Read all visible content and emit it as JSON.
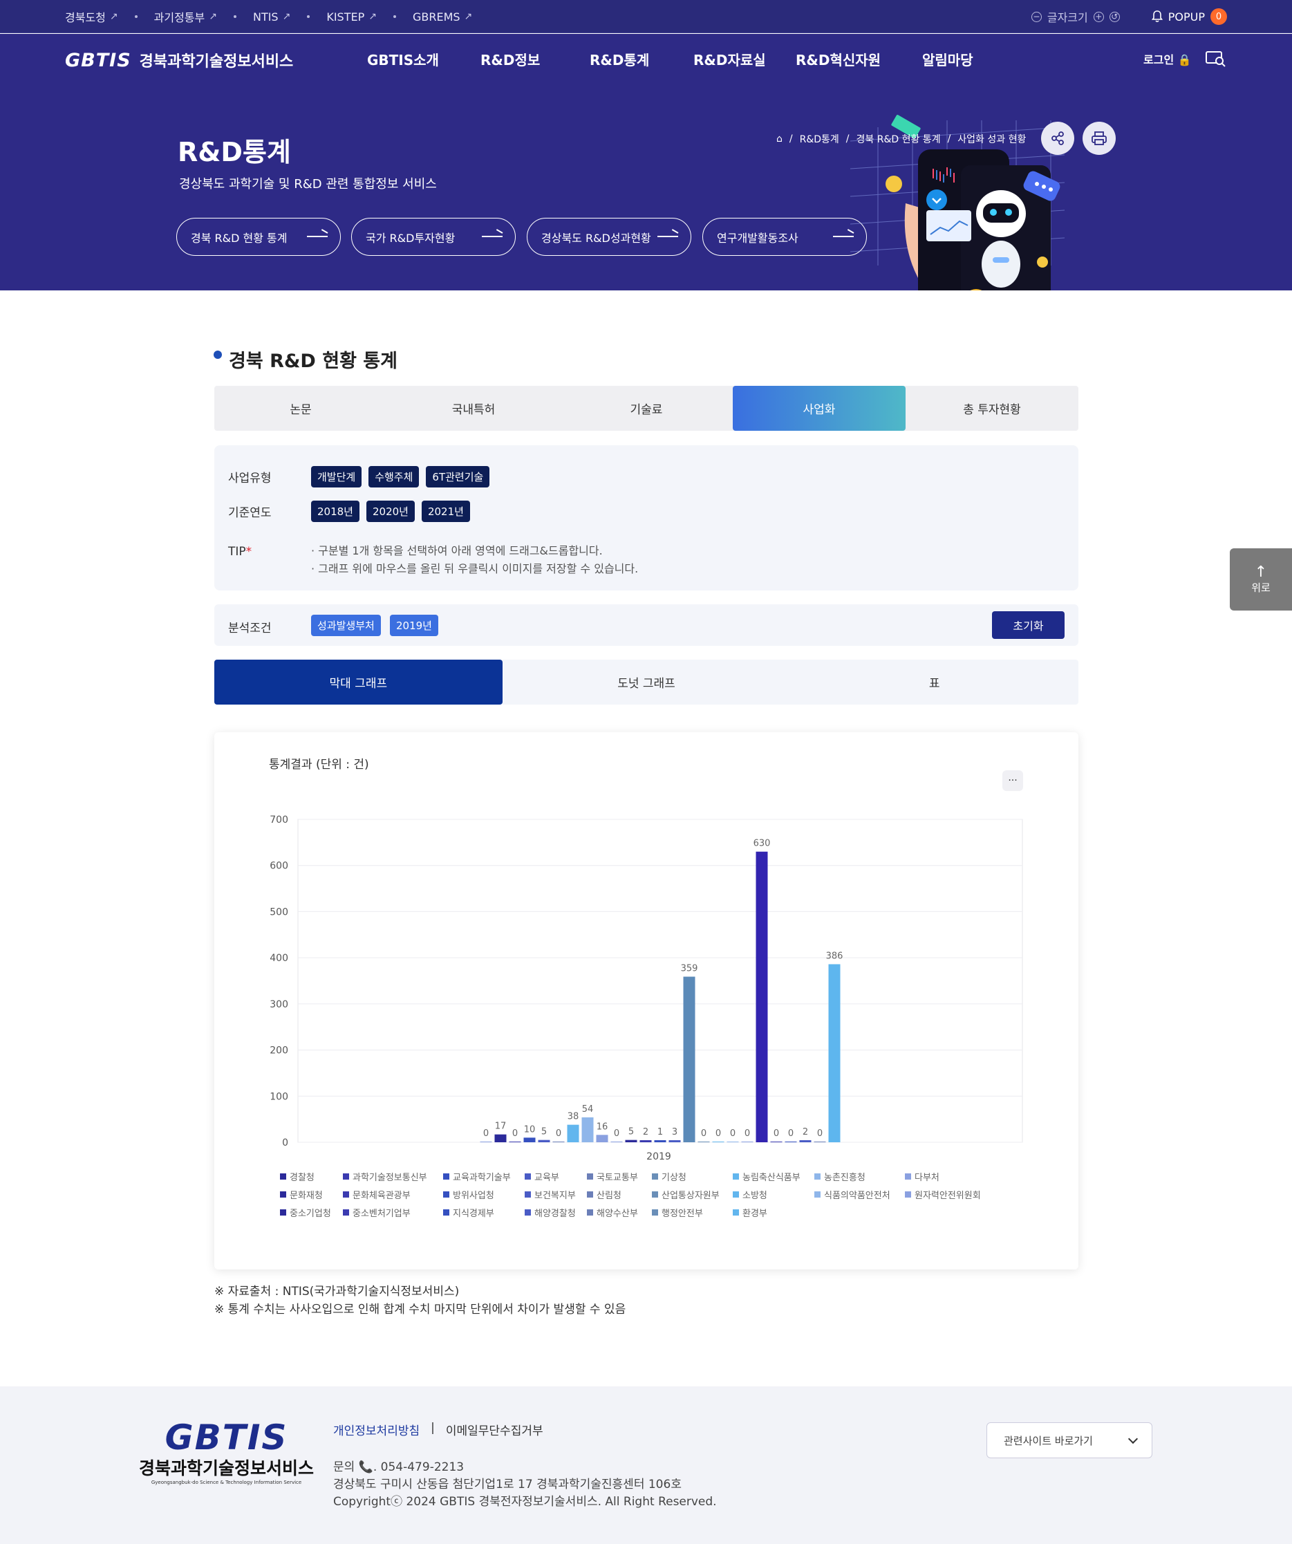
{
  "topbar": {
    "links": [
      {
        "label": "경북도청"
      },
      {
        "label": "과기정통부"
      },
      {
        "label": "NTIS"
      },
      {
        "label": "KISTEP"
      },
      {
        "label": "GBREMS"
      }
    ],
    "font_size_label": "글자크기",
    "popup_label": "POPUP",
    "popup_count": "0"
  },
  "header": {
    "logo_text": "GBTIS",
    "logo_kr": "경북과학기술정보서비스",
    "nav": [
      "GBTIS소개",
      "R&D정보",
      "R&D통계",
      "R&D자료실",
      "R&D혁신자원",
      "알림마당"
    ],
    "login_label": "로그인"
  },
  "hero": {
    "title": "R&D통계",
    "subtitle": "경상북도 과학기술 및 R&D 관련 통합정보 서비스",
    "pills": [
      "경북 R&D 현황 통계",
      "국가 R&D투자현황",
      "경상북도 R&D성과현황",
      "연구개발활동조사"
    ],
    "breadcrumb": [
      "R&D통계",
      "경북 R&D 현황 통계",
      "사업화 성과 현황"
    ]
  },
  "main": {
    "section_title": "경북 R&D 현황 통계",
    "tabs": [
      "논문",
      "국내특허",
      "기술료",
      "사업화",
      "총 투자현황"
    ],
    "active_tab": "사업화",
    "filters": {
      "type_label": "사업유형",
      "type_chips": [
        "개발단계",
        "수행주체",
        "6T관련기술"
      ],
      "year_label": "기준연도",
      "year_chips": [
        "2018년",
        "2020년",
        "2021년"
      ],
      "tip_label": "TIP",
      "tip_lines": [
        "· 구분별 1개 항목을 선택하여 아래 영역에 드래그&드롭합니다.",
        "· 그래프 위에 마우스를 올린 뒤 우클릭시 이미지를 저장할 수 있습니다."
      ]
    },
    "condition": {
      "label": "분석조건",
      "chips": [
        "성과발생부처",
        "2019년"
      ],
      "reset_label": "초기화"
    },
    "graph_tabs": [
      "막대 그래프",
      "도넛 그래프",
      "표"
    ],
    "active_graph_tab": "막대 그래프",
    "chart_title": "통계결과 (단위 : 건)",
    "menu_label": "···",
    "notes": [
      "※ 자료출처 : NTIS(국가과학기술지식정보서비스)",
      "※ 통계 수치는 사사오입으로 인해 합계 수치 마지막 단위에서 차이가 발생할 수 있음"
    ]
  },
  "chart_data": {
    "type": "bar",
    "title": "",
    "xlabel": "",
    "ylabel": "",
    "categories": [
      "2019"
    ],
    "ylim": [
      0,
      700
    ],
    "yticks": [
      0,
      100,
      200,
      300,
      400,
      500,
      600,
      700
    ],
    "grid": true,
    "legend_position": "bottom",
    "label_positions": [
      {
        "name": "경찰청",
        "value": null
      },
      {
        "name": "과학기술정보통신부",
        "value": null
      },
      {
        "name": "교육과학기술부",
        "value": null
      },
      {
        "name": "교육부",
        "value": null
      },
      {
        "name": "국토교통부",
        "value": null
      },
      {
        "name": "기상청",
        "value": null
      },
      {
        "name": "농림축산식품부",
        "value": null
      },
      {
        "name": "농촌진흥청",
        "value": null
      },
      {
        "name": "다부처",
        "value": null
      }
    ],
    "series": [
      {
        "name": "경찰청",
        "values": [
          null
        ],
        "color": "#2b2a9a"
      },
      {
        "name": "과학기술정보통신부",
        "values": [
          null
        ],
        "color": "#3b3bb0"
      },
      {
        "name": "교육과학기술부",
        "values": [
          null
        ],
        "color": "#3550c0"
      },
      {
        "name": "교육부",
        "values": [
          null
        ],
        "color": "#4a5cc6"
      },
      {
        "name": "국토교통부",
        "values": [
          null
        ],
        "color": "#6b7fb8"
      },
      {
        "name": "기상청",
        "values": [
          null
        ],
        "color": "#6a8fb8"
      },
      {
        "name": "농림축산식품부",
        "values": [
          null
        ],
        "color": "#62b6ee"
      },
      {
        "name": "농촌진흥청",
        "values": [
          null
        ],
        "color": "#8fb6ea"
      },
      {
        "name": "다부처",
        "values": [
          0
        ],
        "color": "#8aa0e0"
      },
      {
        "name": "문화재청",
        "values": [
          17
        ],
        "color": "#2b2a9a"
      },
      {
        "name": "문화체육관광부",
        "values": [
          0
        ],
        "color": "#3b3bb0"
      },
      {
        "name": "방위사업청",
        "values": [
          10
        ],
        "color": "#3550c0"
      },
      {
        "name": "보건복지부",
        "values": [
          5
        ],
        "color": "#4a5cc6"
      },
      {
        "name": "산림청",
        "values": [
          0
        ],
        "color": "#6b7fb8"
      },
      {
        "name": "산업통상자원부",
        "values": [
          38
        ],
        "color": "#62b6ee"
      },
      {
        "name": "소방청",
        "values": [
          54
        ],
        "color": "#8fb6ea"
      },
      {
        "name": "식품의약품안전처",
        "values": [
          16
        ],
        "color": "#8aa0e0"
      },
      {
        "name": "원자력안전위원회",
        "values": [
          0
        ],
        "color": "#8aa0e0"
      },
      {
        "name": "중소기업청",
        "values": [
          5
        ],
        "color": "#2b2a9a"
      },
      {
        "name": "중소벤처기업부",
        "values": [
          2
        ],
        "color": "#3b3bb0"
      },
      {
        "name": "지식경제부",
        "values": [
          1
        ],
        "color": "#3550c0"
      },
      {
        "name": "해양경찰청",
        "values": [
          3
        ],
        "color": "#4a5cc6"
      },
      {
        "name": "해양수산부",
        "values": [
          359
        ],
        "color": "#5b8ab8"
      },
      {
        "name": "행정안전부",
        "values": [
          0
        ],
        "color": "#6a8fb8"
      },
      {
        "name": "환경부",
        "values": [
          0
        ],
        "color": "#62b6ee"
      }
    ],
    "bars": [
      {
        "label": "0",
        "value": 0,
        "color": "#8aa0e0"
      },
      {
        "label": "17",
        "value": 17,
        "color": "#2b2a9a"
      },
      {
        "label": "0",
        "value": 0,
        "color": "#3b3bb0"
      },
      {
        "label": "10",
        "value": 10,
        "color": "#3550c0"
      },
      {
        "label": "5",
        "value": 5,
        "color": "#4a5cc6"
      },
      {
        "label": "0",
        "value": 0,
        "color": "#6b7fb8"
      },
      {
        "label": "38",
        "value": 38,
        "color": "#62b6ee"
      },
      {
        "label": "54",
        "value": 54,
        "color": "#8fb6ea"
      },
      {
        "label": "16",
        "value": 16,
        "color": "#8aa0e0"
      },
      {
        "label": "0",
        "value": 0,
        "color": "#8aa0e0"
      },
      {
        "label": "5",
        "value": 5,
        "color": "#2b2a9a"
      },
      {
        "label": "2",
        "value": 2,
        "color": "#3b3bb0"
      },
      {
        "label": "1",
        "value": 1,
        "color": "#3550c0"
      },
      {
        "label": "3",
        "value": 3,
        "color": "#4a5cc6"
      },
      {
        "label": "359",
        "value": 359,
        "color": "#5b8ab8"
      },
      {
        "label": "0",
        "value": 0,
        "color": "#6a8fb8"
      },
      {
        "label": "0",
        "value": 0,
        "color": "#62b6ee"
      },
      {
        "label": "0",
        "value": 0,
        "color": "#8fb6ea"
      },
      {
        "label": "0",
        "value": 0,
        "color": "#8aa0e0"
      },
      {
        "label": "630",
        "value": 630,
        "color": "#3224b0"
      },
      {
        "label": "0",
        "value": 0,
        "color": "#3b3bb0"
      },
      {
        "label": "0",
        "value": 0,
        "color": "#3550c0"
      },
      {
        "label": "2",
        "value": 2,
        "color": "#4a5cc6"
      },
      {
        "label": "0",
        "value": 0,
        "color": "#6b7fb8"
      },
      {
        "label": "386",
        "value": 386,
        "color": "#5eb6ee"
      }
    ],
    "legend": [
      {
        "name": "경찰청",
        "color": "#2b2a9a"
      },
      {
        "name": "과학기술정보통신부",
        "color": "#3b3bb0"
      },
      {
        "name": "교육과학기술부",
        "color": "#3550c0"
      },
      {
        "name": "교육부",
        "color": "#4a5cc6"
      },
      {
        "name": "국토교통부",
        "color": "#6b7fb8"
      },
      {
        "name": "기상청",
        "color": "#6a8fb8"
      },
      {
        "name": "농림축산식품부",
        "color": "#62b6ee"
      },
      {
        "name": "농촌진흥청",
        "color": "#8fb6ea"
      },
      {
        "name": "다부처",
        "color": "#8aa0e0"
      },
      {
        "name": "문화재청",
        "color": "#2b2a9a"
      },
      {
        "name": "문화체육관광부",
        "color": "#3b3bb0"
      },
      {
        "name": "방위사업청",
        "color": "#3550c0"
      },
      {
        "name": "보건복지부",
        "color": "#4a5cc6"
      },
      {
        "name": "산림청",
        "color": "#6b7fb8"
      },
      {
        "name": "산업통상자원부",
        "color": "#6a8fb8"
      },
      {
        "name": "소방청",
        "color": "#62b6ee"
      },
      {
        "name": "식품의약품안전처",
        "color": "#8fb6ea"
      },
      {
        "name": "원자력안전위원회",
        "color": "#8aa0e0"
      },
      {
        "name": "중소기업청",
        "color": "#2b2a9a"
      },
      {
        "name": "중소벤처기업부",
        "color": "#3b3bb0"
      },
      {
        "name": "지식경제부",
        "color": "#3550c0"
      },
      {
        "name": "해양경찰청",
        "color": "#4a5cc6"
      },
      {
        "name": "해양수산부",
        "color": "#6b7fb8"
      },
      {
        "name": "행정안전부",
        "color": "#6a8fb8"
      },
      {
        "name": "환경부",
        "color": "#62b6ee"
      }
    ]
  },
  "footer": {
    "logo_text": "GBTIS",
    "logo_kr": "경북과학기술정보서비스",
    "logo_en": "Gyeongsangbuk-do Science & Technology Information Service",
    "links": [
      "개인정보처리방침",
      "이메일무단수집거부"
    ],
    "contact": "문의 📞. 054-479-2213",
    "address": "경상북도 구미시 산동읍 첨단기업1로 17 경북과학기술진흥센터 106호",
    "copyright": "Copyrightⓒ 2024 GBTIS 경북전자정보기술서비스. All Right Reserved.",
    "related_sites_label": "관련사이트 바로가기"
  },
  "to_top_label": "위로",
  "colors": {
    "brand_navy": "#2e2a86",
    "accent_blue": "#3b6fe0",
    "dark_chip": "#0d1e56",
    "popup_badge": "#ff6a2b"
  }
}
